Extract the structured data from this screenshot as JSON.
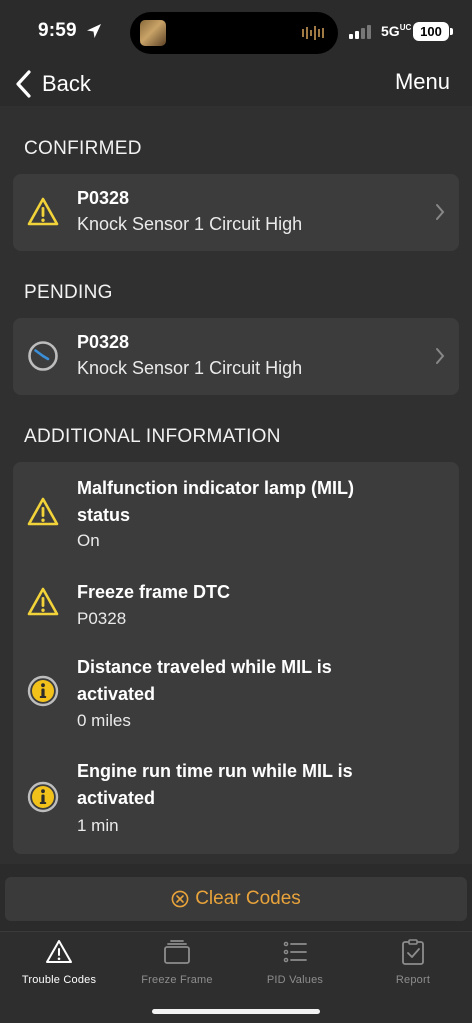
{
  "status_bar": {
    "time": "9:59",
    "network": "5G",
    "network_suffix": "UC",
    "battery": "100"
  },
  "nav": {
    "back_label": "Back",
    "menu_label": "Menu"
  },
  "sections": {
    "confirmed": "CONFIRMED",
    "pending": "PENDING",
    "additional": "ADDITIONAL INFORMATION"
  },
  "confirmed_code": {
    "code": "P0328",
    "description": "Knock Sensor 1 Circuit High",
    "icon": "warning-icon"
  },
  "pending_code": {
    "code": "P0328",
    "description": "Knock Sensor 1 Circuit High",
    "icon": "clock-icon"
  },
  "additional_info": [
    {
      "title": "Malfunction indicator lamp (MIL) status",
      "value": "On",
      "icon": "warning-icon"
    },
    {
      "title": "Freeze frame DTC",
      "value": "P0328",
      "icon": "warning-icon"
    },
    {
      "title": "Distance traveled while MIL is activated",
      "value": "0 miles",
      "icon": "info-icon"
    },
    {
      "title": "Engine run time run while MIL is activated",
      "value": "1 min",
      "icon": "info-icon"
    }
  ],
  "clear_codes_label": "Clear Codes",
  "tabs": [
    {
      "label": "Trouble Codes",
      "icon": "warning-triangle-icon",
      "active": true
    },
    {
      "label": "Freeze Frame",
      "icon": "freeze-frame-icon",
      "active": false
    },
    {
      "label": "PID Values",
      "icon": "list-icon",
      "active": false
    },
    {
      "label": "Report",
      "icon": "clipboard-check-icon",
      "active": false
    }
  ],
  "colors": {
    "background": "#2b2b2b",
    "card": "#3c3c3c",
    "accent_orange": "#e8a33a",
    "warning_yellow": "#f2d33a",
    "clock_blue": "#3b8ed8"
  }
}
